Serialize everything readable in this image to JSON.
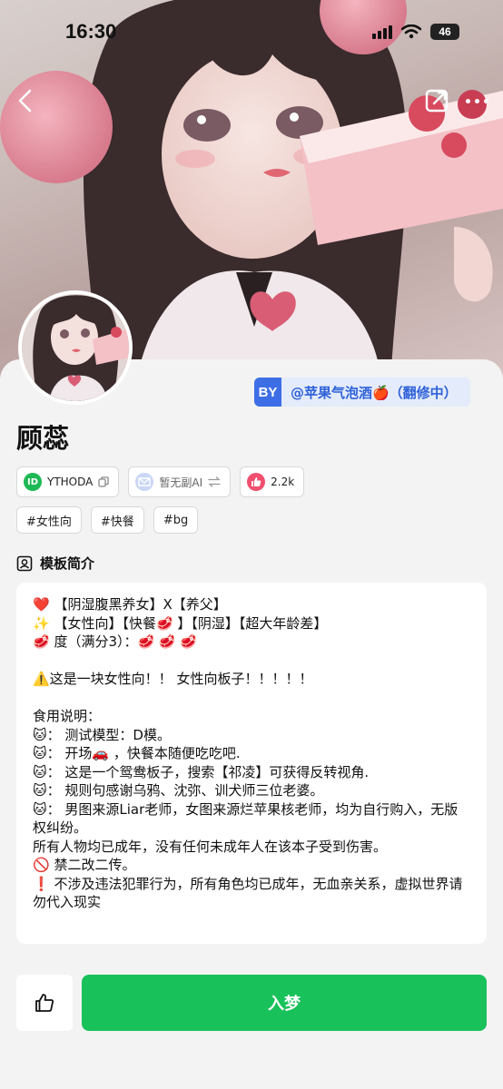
{
  "status_bar": {
    "time": "16:30",
    "battery": "46"
  },
  "author": {
    "badge": "BY",
    "name": "@苹果气泡酒🍎（翻修中）"
  },
  "title": "顾蕊",
  "chips": [
    {
      "icon": "id-icon",
      "label": "YTHODA",
      "accent": "#1db954"
    },
    {
      "icon": "ai-model-icon",
      "label": "暂无副AI",
      "accent": "#8fa9e8"
    },
    {
      "icon": "thumbs-up-icon",
      "label": "2.2k",
      "accent": "#f0506e"
    }
  ],
  "tags": [
    "#女性向",
    "#快餐",
    "#bg"
  ],
  "section_title": "模板简介",
  "description": [
    "❤️ 【阴湿腹黑养女】X【养父】",
    "✨ 【女性向】【快餐🥩 】【阴湿】【超大年龄差】",
    "🥩 度（满分3）：🥩 🥩 🥩",
    "",
    "⚠️这是一块女性向！！ 女性向板子！！！！！",
    "",
    "食用说明：",
    "🐱： 测试模型：D模。",
    "🐱： 开场🚗 ，快餐本随便吃吃吧.",
    "🐱： 这是一个鸳鸯板子，搜索【祁凌】可获得反转视角.",
    "🐱： 规则句感谢乌鸦、沈弥、训犬师三位老婆。",
    "🐱： 男图来源Liar老师，女图来源烂苹果核老师，均为自行购入，无版权纠纷。",
    "所有人物均已成年，没有任何未成年人在该本子受到伤害。",
    "🚫 禁二改二传。",
    "❗ 不涉及违法犯罪行为，所有角色均已成年，无血亲关系，虚拟世界请勿代入现实"
  ],
  "actions": {
    "enter_label": "入梦"
  },
  "colors": {
    "accent_green": "#19c15a",
    "author_blue": "#2f62d8"
  }
}
